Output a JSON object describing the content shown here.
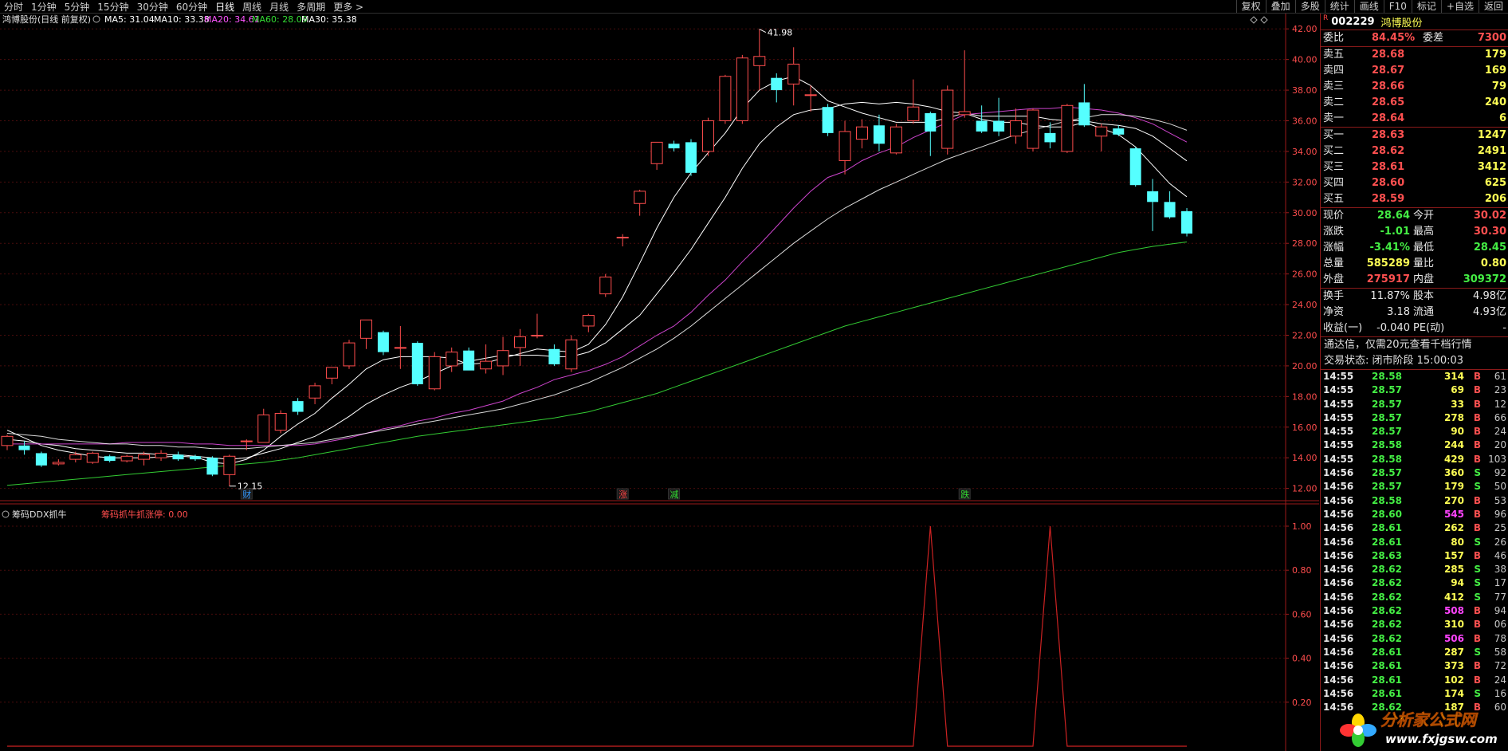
{
  "toolbar": {
    "timeframes": [
      "分时",
      "1分钟",
      "5分钟",
      "15分钟",
      "30分钟",
      "60分钟",
      "日线",
      "周线",
      "月线",
      "多周期",
      "更多 >"
    ],
    "active": "日线",
    "right_buttons": [
      "复权",
      "叠加",
      "多股",
      "统计",
      "画线",
      "F10",
      "标记",
      "+自选",
      "返回"
    ]
  },
  "chart": {
    "stock_label": "鸿博股份(日线 前复权)",
    "ma_legend": [
      {
        "text": "MA5: 31.04",
        "color": "#ffffff"
      },
      {
        "text": "MA10: 33.38",
        "color": "#ffffff"
      },
      {
        "text": "MA20: 34.61",
        "color": "#ff55ff"
      },
      {
        "text": "MA60: 28.09",
        "color": "#33dd33"
      },
      {
        "text": "MA30: 35.38",
        "color": "#ffffff"
      }
    ],
    "y_ticks": [
      "42.00",
      "40.00",
      "38.00",
      "36.00",
      "34.00",
      "32.00",
      "30.00",
      "28.00",
      "26.00",
      "24.00",
      "22.00",
      "20.00",
      "18.00",
      "16.00",
      "14.00",
      "12.00"
    ],
    "high_label": "41.98",
    "low_label": "12.15",
    "markers": [
      {
        "text": "财",
        "color": "#3399ff"
      },
      {
        "text": "涨",
        "color": "#ff4444"
      },
      {
        "text": "减",
        "color": "#33dd33"
      },
      {
        "text": "跌",
        "color": "#33dd33"
      }
    ],
    "colors": {
      "up": "#ff4d4d",
      "down": "#55ffff",
      "grid": "#4a0c0c",
      "axis": "#9b1a1a"
    },
    "candles": [
      {
        "o": 14.8,
        "h": 15.5,
        "l": 14.5,
        "c": 15.4
      },
      {
        "o": 14.8,
        "h": 15.1,
        "l": 14.2,
        "c": 14.5
      },
      {
        "o": 14.3,
        "h": 14.4,
        "l": 13.4,
        "c": 13.5
      },
      {
        "o": 13.6,
        "h": 13.9,
        "l": 13.5,
        "c": 13.7
      },
      {
        "o": 13.9,
        "h": 14.4,
        "l": 13.7,
        "c": 14.2
      },
      {
        "o": 13.7,
        "h": 14.4,
        "l": 13.6,
        "c": 14.3
      },
      {
        "o": 14.1,
        "h": 14.2,
        "l": 13.7,
        "c": 13.8
      },
      {
        "o": 13.8,
        "h": 14.2,
        "l": 13.7,
        "c": 14.1
      },
      {
        "o": 13.9,
        "h": 14.4,
        "l": 13.5,
        "c": 14.2
      },
      {
        "o": 14.0,
        "h": 14.5,
        "l": 13.8,
        "c": 14.3
      },
      {
        "o": 14.2,
        "h": 14.4,
        "l": 13.8,
        "c": 13.9
      },
      {
        "o": 14.1,
        "h": 14.2,
        "l": 13.8,
        "c": 13.9
      },
      {
        "o": 14.0,
        "h": 14.1,
        "l": 12.8,
        "c": 12.9
      },
      {
        "o": 12.9,
        "h": 14.2,
        "l": 12.15,
        "c": 14.1
      },
      {
        "o": 15.1,
        "h": 15.2,
        "l": 14.5,
        "c": 15.1
      },
      {
        "o": 15.0,
        "h": 17.2,
        "l": 15.0,
        "c": 16.8
      },
      {
        "o": 15.8,
        "h": 17.1,
        "l": 15.6,
        "c": 16.9
      },
      {
        "o": 17.7,
        "h": 17.9,
        "l": 16.8,
        "c": 17.0
      },
      {
        "o": 17.9,
        "h": 18.9,
        "l": 17.5,
        "c": 18.7
      },
      {
        "o": 19.2,
        "h": 19.9,
        "l": 18.8,
        "c": 19.9
      },
      {
        "o": 20.0,
        "h": 21.7,
        "l": 19.8,
        "c": 21.5
      },
      {
        "o": 21.8,
        "h": 23.0,
        "l": 21.1,
        "c": 23.0
      },
      {
        "o": 22.2,
        "h": 22.3,
        "l": 20.7,
        "c": 20.9
      },
      {
        "o": 21.2,
        "h": 22.6,
        "l": 19.8,
        "c": 21.2
      },
      {
        "o": 21.5,
        "h": 21.6,
        "l": 18.7,
        "c": 18.8
      },
      {
        "o": 18.5,
        "h": 20.9,
        "l": 18.4,
        "c": 20.6
      },
      {
        "o": 20.0,
        "h": 21.2,
        "l": 19.6,
        "c": 20.9
      },
      {
        "o": 21.0,
        "h": 21.2,
        "l": 19.8,
        "c": 19.7
      },
      {
        "o": 19.8,
        "h": 21.4,
        "l": 19.5,
        "c": 20.3
      },
      {
        "o": 20.0,
        "h": 21.9,
        "l": 19.4,
        "c": 21.0
      },
      {
        "o": 21.2,
        "h": 22.4,
        "l": 20.0,
        "c": 21.9
      },
      {
        "o": 22.0,
        "h": 23.4,
        "l": 21.8,
        "c": 22.0
      },
      {
        "o": 21.1,
        "h": 21.4,
        "l": 20.0,
        "c": 20.1
      },
      {
        "o": 19.8,
        "h": 22.0,
        "l": 19.6,
        "c": 21.7
      },
      {
        "o": 22.6,
        "h": 23.4,
        "l": 22.2,
        "c": 23.3
      },
      {
        "o": 24.7,
        "h": 26.0,
        "l": 24.5,
        "c": 25.8
      },
      {
        "o": 28.4,
        "h": 28.6,
        "l": 27.8,
        "c": 28.4
      },
      {
        "o": 30.6,
        "h": 31.5,
        "l": 29.8,
        "c": 31.4
      },
      {
        "o": 33.2,
        "h": 34.6,
        "l": 32.8,
        "c": 34.6
      },
      {
        "o": 34.5,
        "h": 34.7,
        "l": 34.0,
        "c": 34.2
      },
      {
        "o": 34.6,
        "h": 34.8,
        "l": 32.4,
        "c": 32.6
      },
      {
        "o": 34.0,
        "h": 36.2,
        "l": 33.7,
        "c": 36.0
      },
      {
        "o": 36.0,
        "h": 39.0,
        "l": 35.8,
        "c": 38.9
      },
      {
        "o": 36.0,
        "h": 40.3,
        "l": 35.8,
        "c": 40.1
      },
      {
        "o": 39.6,
        "h": 41.98,
        "l": 38.0,
        "c": 40.2
      },
      {
        "o": 38.8,
        "h": 39.1,
        "l": 37.2,
        "c": 38.0
      },
      {
        "o": 38.4,
        "h": 40.8,
        "l": 37.0,
        "c": 39.7
      },
      {
        "o": 37.7,
        "h": 38.3,
        "l": 36.6,
        "c": 37.7
      },
      {
        "o": 36.9,
        "h": 37.1,
        "l": 35.0,
        "c": 35.2
      },
      {
        "o": 33.4,
        "h": 36.0,
        "l": 32.5,
        "c": 35.3
      },
      {
        "o": 34.8,
        "h": 36.1,
        "l": 34.2,
        "c": 35.6
      },
      {
        "o": 35.7,
        "h": 36.4,
        "l": 34.0,
        "c": 34.5
      },
      {
        "o": 33.9,
        "h": 35.8,
        "l": 33.8,
        "c": 35.6
      },
      {
        "o": 36.0,
        "h": 38.7,
        "l": 35.8,
        "c": 36.9
      },
      {
        "o": 36.5,
        "h": 36.6,
        "l": 33.7,
        "c": 35.3
      },
      {
        "o": 34.2,
        "h": 38.3,
        "l": 33.8,
        "c": 38.0
      },
      {
        "o": 36.4,
        "h": 40.6,
        "l": 36.2,
        "c": 36.6
      },
      {
        "o": 36.0,
        "h": 37.0,
        "l": 35.2,
        "c": 35.3
      },
      {
        "o": 36.0,
        "h": 37.5,
        "l": 35.0,
        "c": 35.3
      },
      {
        "o": 35.0,
        "h": 36.8,
        "l": 34.5,
        "c": 36.0
      },
      {
        "o": 34.2,
        "h": 36.8,
        "l": 34.0,
        "c": 36.7
      },
      {
        "o": 35.2,
        "h": 35.9,
        "l": 34.2,
        "c": 34.6
      },
      {
        "o": 34.0,
        "h": 37.1,
        "l": 33.9,
        "c": 37.0
      },
      {
        "o": 37.2,
        "h": 38.4,
        "l": 35.6,
        "c": 35.7
      },
      {
        "o": 35.0,
        "h": 35.8,
        "l": 34.0,
        "c": 35.6
      },
      {
        "o": 35.5,
        "h": 35.7,
        "l": 35.0,
        "c": 35.1
      },
      {
        "o": 34.2,
        "h": 34.3,
        "l": 31.7,
        "c": 31.8
      },
      {
        "o": 31.4,
        "h": 32.2,
        "l": 28.8,
        "c": 30.7
      },
      {
        "o": 30.7,
        "h": 31.4,
        "l": 29.6,
        "c": 29.7
      },
      {
        "o": 30.1,
        "h": 30.3,
        "l": 28.45,
        "c": 28.64
      }
    ],
    "ma": {
      "MA5": [
        15.8,
        15.3,
        14.8,
        14.5,
        14.3,
        14.1,
        14.0,
        14.0,
        14.0,
        14.05,
        14.1,
        14.05,
        13.7,
        13.6,
        13.9,
        14.5,
        15.4,
        16.2,
        16.9,
        17.9,
        18.8,
        19.8,
        20.4,
        20.6,
        20.6,
        20.6,
        20.5,
        20.1,
        20.2,
        20.5,
        20.8,
        21.1,
        21.0,
        20.9,
        21.4,
        22.7,
        24.5,
        26.7,
        29.0,
        31.0,
        32.6,
        33.9,
        35.2,
        36.8,
        38.0,
        38.6,
        38.9,
        38.3,
        37.3,
        36.9,
        36.5,
        36.2,
        35.9,
        35.9,
        35.9,
        36.2,
        36.5,
        36.1,
        35.9,
        35.9,
        35.7,
        35.6,
        35.6,
        35.9,
        35.5,
        35.1,
        34.3,
        33.1,
        31.9,
        31.04
      ],
      "MA10": [
        15.2,
        15.1,
        14.9,
        14.8,
        14.6,
        14.5,
        14.4,
        14.3,
        14.3,
        14.2,
        14.2,
        14.1,
        14.0,
        13.9,
        14.0,
        14.3,
        14.6,
        15.0,
        15.4,
        16.0,
        16.7,
        17.5,
        18.1,
        18.6,
        19.0,
        19.5,
        20.0,
        20.3,
        20.5,
        20.7,
        20.7,
        20.7,
        20.6,
        20.6,
        20.9,
        21.5,
        22.4,
        23.3,
        24.7,
        26.1,
        27.6,
        29.3,
        31.0,
        32.9,
        34.5,
        35.6,
        36.4,
        36.7,
        36.8,
        37.1,
        37.2,
        37.1,
        37.2,
        37.1,
        36.9,
        36.6,
        36.5,
        36.3,
        36.3,
        36.3,
        36.3,
        36.1,
        36.0,
        36.0,
        35.8,
        35.7,
        35.5,
        35.0,
        34.2,
        33.38
      ],
      "MA20": [
        14.9,
        14.9,
        14.9,
        14.9,
        14.9,
        14.9,
        14.9,
        15.0,
        15.0,
        15.0,
        15.0,
        14.9,
        14.9,
        14.8,
        14.8,
        14.8,
        14.8,
        14.8,
        14.9,
        15.1,
        15.3,
        15.6,
        15.9,
        16.1,
        16.4,
        16.6,
        16.9,
        17.1,
        17.4,
        17.7,
        18.2,
        18.6,
        19.1,
        19.4,
        19.7,
        20.1,
        20.6,
        21.3,
        22.0,
        22.6,
        23.5,
        24.6,
        25.6,
        26.8,
        27.9,
        29.1,
        30.3,
        31.4,
        32.3,
        32.7,
        33.4,
        33.9,
        34.3,
        34.9,
        35.4,
        35.9,
        36.4,
        36.5,
        36.6,
        36.7,
        36.8,
        36.8,
        36.9,
        36.8,
        36.7,
        36.5,
        36.2,
        35.8,
        35.2,
        34.61
      ],
      "MA30": [
        15.6,
        15.5,
        15.4,
        15.2,
        15.1,
        15.0,
        14.9,
        14.9,
        14.8,
        14.8,
        14.7,
        14.7,
        14.6,
        14.6,
        14.6,
        14.7,
        14.8,
        14.9,
        15.0,
        15.2,
        15.4,
        15.6,
        15.8,
        16.0,
        16.2,
        16.4,
        16.6,
        16.8,
        17.0,
        17.2,
        17.5,
        17.8,
        18.1,
        18.5,
        18.9,
        19.4,
        19.9,
        20.5,
        21.1,
        21.8,
        22.6,
        23.5,
        24.4,
        25.3,
        26.2,
        27.1,
        28.0,
        28.8,
        29.6,
        30.3,
        30.9,
        31.5,
        32.0,
        32.5,
        33.0,
        33.5,
        33.9,
        34.3,
        34.7,
        35.1,
        35.4,
        35.7,
        36.0,
        36.2,
        36.4,
        36.4,
        36.3,
        36.1,
        35.8,
        35.38
      ],
      "MA60": [
        12.2,
        12.3,
        12.4,
        12.5,
        12.6,
        12.7,
        12.8,
        12.9,
        13.0,
        13.1,
        13.2,
        13.3,
        13.4,
        13.5,
        13.6,
        13.7,
        13.85,
        14.0,
        14.2,
        14.4,
        14.6,
        14.8,
        15.0,
        15.2,
        15.4,
        15.55,
        15.7,
        15.85,
        16.0,
        16.15,
        16.3,
        16.45,
        16.6,
        16.8,
        17.0,
        17.3,
        17.6,
        17.9,
        18.2,
        18.6,
        19.0,
        19.4,
        19.8,
        20.2,
        20.6,
        21.0,
        21.4,
        21.8,
        22.2,
        22.6,
        22.9,
        23.2,
        23.5,
        23.8,
        24.1,
        24.4,
        24.7,
        25.0,
        25.3,
        25.6,
        25.9,
        26.2,
        26.5,
        26.8,
        27.1,
        27.4,
        27.6,
        27.8,
        27.95,
        28.09
      ]
    },
    "indicator": {
      "name": "筹码DDX抓牛",
      "line_label": "筹码抓牛抓涨停: 0.00",
      "y_ticks": [
        "1.00",
        "0.80",
        "0.60",
        "0.40",
        "0.20"
      ],
      "values": [
        0,
        0,
        0,
        0,
        0,
        0,
        0,
        0,
        0,
        0,
        0,
        0,
        0,
        0,
        0,
        0,
        0,
        0,
        0,
        0,
        0,
        0,
        0,
        0,
        0,
        0,
        0,
        0,
        0,
        0,
        0,
        0,
        0,
        0,
        0,
        0,
        0,
        0,
        0,
        0,
        0,
        0,
        0,
        0,
        0,
        0,
        0,
        0,
        0,
        0,
        0,
        0,
        0,
        0,
        1,
        0,
        0,
        0,
        0,
        0,
        0,
        1,
        0,
        0,
        0,
        0,
        0,
        0,
        0,
        0
      ]
    }
  },
  "panel": {
    "code": "002229",
    "name": "鸿博股份",
    "r": "R",
    "weibi": {
      "label": "委比",
      "pct": "84.45%",
      "label2": "委差",
      "val": "7300"
    },
    "asks": [
      {
        "label": "卖五",
        "price": "28.68",
        "vol": "179"
      },
      {
        "label": "卖四",
        "price": "28.67",
        "vol": "169"
      },
      {
        "label": "卖三",
        "price": "28.66",
        "vol": "79"
      },
      {
        "label": "卖二",
        "price": "28.65",
        "vol": "240"
      },
      {
        "label": "卖一",
        "price": "28.64",
        "vol": "6"
      }
    ],
    "bids": [
      {
        "label": "买一",
        "price": "28.63",
        "vol": "1247"
      },
      {
        "label": "买二",
        "price": "28.62",
        "vol": "2491"
      },
      {
        "label": "买三",
        "price": "28.61",
        "vol": "3412"
      },
      {
        "label": "买四",
        "price": "28.60",
        "vol": "625"
      },
      {
        "label": "买五",
        "price": "28.59",
        "vol": "206"
      }
    ],
    "stats": [
      {
        "l1": "现价",
        "v1": "28.64",
        "c1": "grn",
        "l2": "今开",
        "v2": "30.02",
        "c2": "red"
      },
      {
        "l1": "涨跌",
        "v1": "-1.01",
        "c1": "grn",
        "l2": "最高",
        "v2": "30.30",
        "c2": "red"
      },
      {
        "l1": "涨幅",
        "v1": "-3.41%",
        "c1": "grn",
        "l2": "最低",
        "v2": "28.45",
        "c2": "grn"
      },
      {
        "l1": "总量",
        "v1": "585289",
        "c1": "yel",
        "l2": "量比",
        "v2": "0.80",
        "c2": "yel"
      },
      {
        "l1": "外盘",
        "v1": "275917",
        "c1": "red",
        "l2": "内盘",
        "v2": "309372",
        "c2": "grn"
      }
    ],
    "stats2": [
      {
        "l1": "换手",
        "v1": "11.87%",
        "l2": "股本",
        "v2": "4.98亿"
      },
      {
        "l1": "净资",
        "v1": "3.18",
        "l2": "流通",
        "v2": "4.93亿"
      },
      {
        "l1": "收益(一)",
        "v1": "-0.040",
        "l2": "PE(动)",
        "v2": "-"
      }
    ],
    "notice1": "通达信，仅需20元查看千档行情",
    "notice2": "交易状态: 闭市阶段 15:00:03",
    "ticks": [
      {
        "t": "14:55",
        "p": "28.58",
        "v": "314",
        "s": "B",
        "n": "61"
      },
      {
        "t": "14:55",
        "p": "28.57",
        "v": "69",
        "s": "B",
        "n": "23"
      },
      {
        "t": "14:55",
        "p": "28.57",
        "v": "33",
        "s": "B",
        "n": "12"
      },
      {
        "t": "14:55",
        "p": "28.57",
        "v": "278",
        "s": "B",
        "n": "66"
      },
      {
        "t": "14:55",
        "p": "28.57",
        "v": "90",
        "s": "B",
        "n": "24"
      },
      {
        "t": "14:55",
        "p": "28.58",
        "v": "244",
        "s": "B",
        "n": "20"
      },
      {
        "t": "14:55",
        "p": "28.58",
        "v": "429",
        "s": "B",
        "n": "103"
      },
      {
        "t": "14:56",
        "p": "28.57",
        "v": "360",
        "s": "S",
        "n": "92"
      },
      {
        "t": "14:56",
        "p": "28.57",
        "v": "179",
        "s": "S",
        "n": "50"
      },
      {
        "t": "14:56",
        "p": "28.58",
        "v": "270",
        "s": "B",
        "n": "53"
      },
      {
        "t": "14:56",
        "p": "28.60",
        "v": "545",
        "s": "B",
        "n": "96"
      },
      {
        "t": "14:56",
        "p": "28.61",
        "v": "262",
        "s": "B",
        "n": "25"
      },
      {
        "t": "14:56",
        "p": "28.61",
        "v": "80",
        "s": "S",
        "n": "26"
      },
      {
        "t": "14:56",
        "p": "28.63",
        "v": "157",
        "s": "B",
        "n": "46"
      },
      {
        "t": "14:56",
        "p": "28.62",
        "v": "285",
        "s": "S",
        "n": "38"
      },
      {
        "t": "14:56",
        "p": "28.62",
        "v": "94",
        "s": "S",
        "n": "17"
      },
      {
        "t": "14:56",
        "p": "28.62",
        "v": "412",
        "s": "S",
        "n": "77"
      },
      {
        "t": "14:56",
        "p": "28.62",
        "v": "508",
        "s": "B",
        "n": "94"
      },
      {
        "t": "14:56",
        "p": "28.62",
        "v": "310",
        "s": "B",
        "n": "06"
      },
      {
        "t": "14:56",
        "p": "28.62",
        "v": "506",
        "s": "B",
        "n": "78"
      },
      {
        "t": "14:56",
        "p": "28.61",
        "v": "287",
        "s": "S",
        "n": "58"
      },
      {
        "t": "14:56",
        "p": "28.61",
        "v": "373",
        "s": "B",
        "n": "72"
      },
      {
        "t": "14:56",
        "p": "28.61",
        "v": "102",
        "s": "B",
        "n": "24"
      },
      {
        "t": "14:56",
        "p": "28.61",
        "v": "174",
        "s": "S",
        "n": "16"
      },
      {
        "t": "14:56",
        "p": "28.62",
        "v": "187",
        "s": "B",
        "n": "60"
      }
    ]
  },
  "watermark": {
    "title": "分析家公式网",
    "url": "www.fxjgsw.com"
  }
}
